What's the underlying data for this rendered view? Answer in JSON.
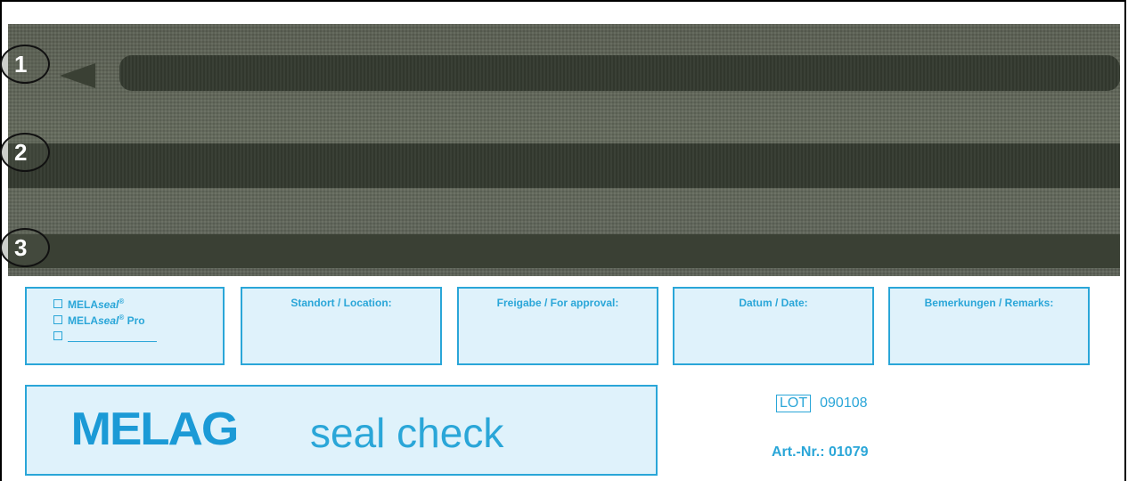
{
  "seals": [
    {
      "number": "1"
    },
    {
      "number": "2"
    },
    {
      "number": "3"
    }
  ],
  "boxes": {
    "products": [
      {
        "brand": "MELA",
        "suffix": "seal",
        "mark": "®",
        "extra": ""
      },
      {
        "brand": "MELA",
        "suffix": "seal",
        "mark": "®",
        "extra": " Pro"
      }
    ],
    "location_label": "Standort / Location:",
    "approval_label": "Freigabe / For approval:",
    "date_label": "Datum / Date:",
    "remarks_label": "Bemerkungen / Remarks:"
  },
  "brand": {
    "logo": "MELAG",
    "product": "seal check"
  },
  "lot": {
    "label": "LOT",
    "value": "090108"
  },
  "article": "Art.-Nr.: 01079",
  "colors": {
    "accent": "#2aa6d8",
    "logo": "#1b9ad6",
    "panel": "#dff2fb"
  }
}
